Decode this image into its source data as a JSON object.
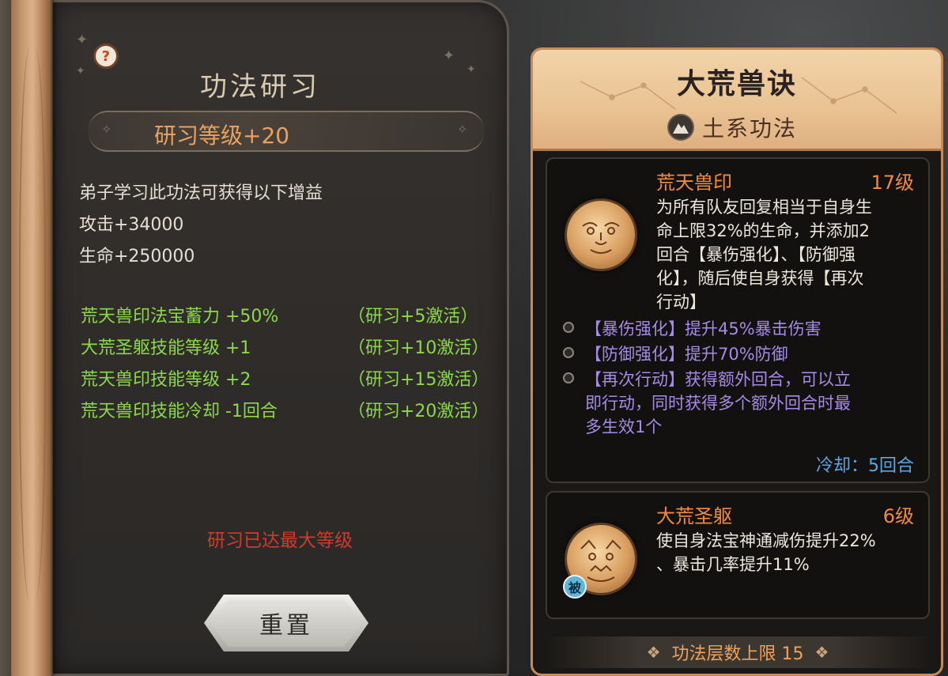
{
  "left": {
    "title": "功法研习",
    "level_bonus": "研习等级+20",
    "description": "弟子学习此功法可获得以下增益",
    "stats": [
      "攻击+34000",
      "生命+250000"
    ],
    "bonuses": [
      {
        "name": "荒天兽印法宝蓄力 +50%",
        "condition": "（研习+5激活）"
      },
      {
        "name": "大荒圣躯技能等级 +1",
        "condition": "（研习+10激活）"
      },
      {
        "name": "荒天兽印技能等级 +2",
        "condition": "（研习+15激活）"
      },
      {
        "name": "荒天兽印技能冷却 -1回合",
        "condition": "（研习+20激活）"
      }
    ],
    "max_level_text": "研习已达最大等级",
    "reset_label": "重置",
    "help_glyph": "?",
    "help_icon": "help-icon"
  },
  "right": {
    "title": "大荒兽诀",
    "element_label": "土系功法",
    "element_icon": "earth-mountain-icon",
    "skills": [
      {
        "name": "荒天兽印",
        "level": "17级",
        "desc_lines": [
          "为所有队友回复相当于自身生",
          "命上限32%的生命，并添加2",
          "回合【暴伤强化】、【防御强",
          "化】，随后使自身获得【再次",
          "行动】"
        ],
        "effects": [
          {
            "lines": [
              "【暴伤强化】提升45%暴击伤害"
            ]
          },
          {
            "lines": [
              "【防御强化】提升70%防御"
            ]
          },
          {
            "lines": [
              "【再次行动】获得额外回合，可以立",
              "即行动，同时获得多个额外回合时最",
              "多生效1个"
            ]
          }
        ],
        "cooldown": "冷却：5回合"
      },
      {
        "name": "大荒圣躯",
        "level": "6级",
        "desc_lines": [
          "使自身法宝神通减伤提升22%",
          "、暴击几率提升11%"
        ],
        "badge": "被"
      }
    ],
    "footer": "功法层数上限 15"
  },
  "colors": {
    "green_bonus": "#8bd946",
    "orange_accent": "#f28b3a",
    "purple_effect": "#a58be6",
    "blue_cooldown": "#5aa8e8",
    "red_warning": "#d03a2c"
  }
}
